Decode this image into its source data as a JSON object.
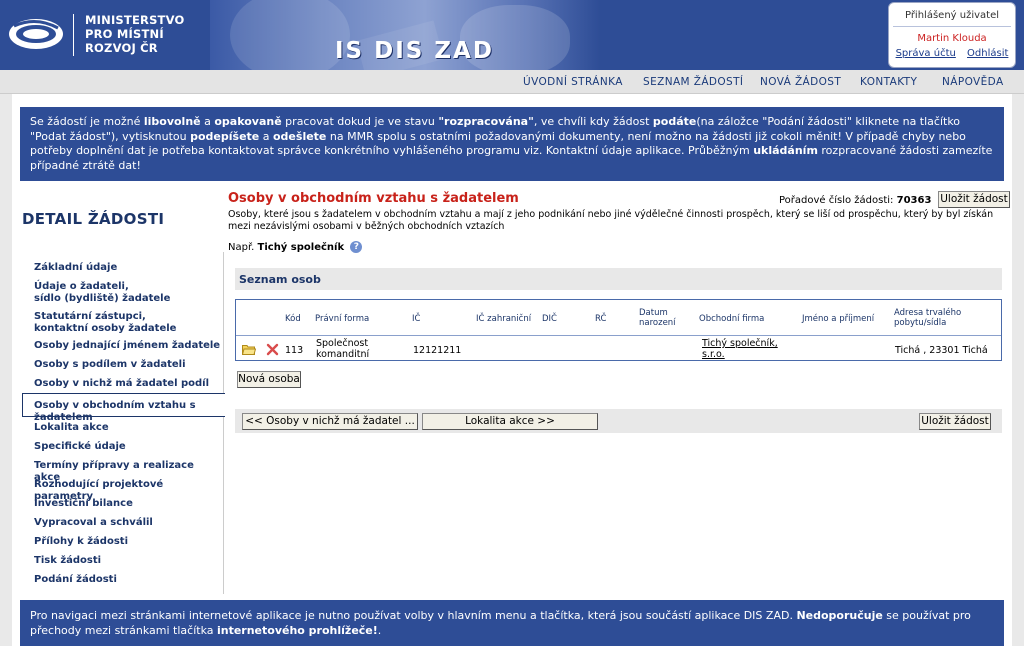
{
  "header": {
    "ministry_lines": [
      "MINISTERSTVO",
      "PRO MÍSTNÍ",
      "ROZVOJ ČR"
    ],
    "app_title": "IS DIS ZAD",
    "user_box_title": "Přihlášený uživatel",
    "user_name": "Martin Klouda",
    "account_link": "Správa účtu",
    "logout_link": "Odhlásit"
  },
  "topnav": [
    "ÚVODNÍ STRÁNKA",
    "SEZNAM ŽÁDOSTÍ",
    "NOVÁ ŽÁDOST",
    "KONTAKTY",
    "NÁPOVĚDA"
  ],
  "info": {
    "p1": "Se žádostí je možné ",
    "b1": "libovolně",
    "p2": " a ",
    "b2": "opakovaně",
    "p3": " pracovat dokud je ve stavu ",
    "b3": "\"rozpracována\"",
    "p4": ", ve chvíli kdy žádost ",
    "b4": "podáte",
    "p5": "(na záložce \"Podání žádosti\" kliknete na tlačítko \"Podat žádost\"), vytisknutou ",
    "b5": "podepíšete",
    "p6": " a ",
    "b6": "odešlete",
    "p7": " na MMR spolu s ostatními požadovanými dokumenty, není možno na žádosti již cokoli měnit! V případě chyby nebo potřeby doplnění dat je potřeba kontaktovat správce konkrétního vyhlášeného programu viz. Kontaktní údaje aplikace. Průběžným ",
    "b7": "ukládáním",
    "p8": " rozpracované žádosti zamezíte případné ztrátě dat!"
  },
  "left": {
    "title": "DETAIL ŽÁDOSTI",
    "items": [
      "Základní údaje",
      "Údaje o žadateli,",
      "sídlo (bydliště) žadatele",
      "Statutární zástupci,",
      "kontaktní osoby žadatele",
      "Osoby jednající jménem žadatele",
      "Osoby s podílem v žadateli",
      "Osoby v nichž má žadatel podíl",
      "Osoby v obchodním vztahu s žadatelem",
      "Lokalita akce",
      "Specifické údaje",
      "Termíny přípravy a realizace akce",
      "Rozhodující projektové parametry",
      "Investiční bilance",
      "Vypracoval a schválil",
      "Přílohy k žádosti",
      "Tisk žádosti",
      "Podání žádosti"
    ]
  },
  "content": {
    "title": "Osoby v obchodním vztahu s žadatelem",
    "seq_label": "Pořadové číslo žádosti:",
    "seq_value": "70363",
    "save_button": "Uložit žádost",
    "description": "Osoby, které jsou s žadatelem v obchodním vztahu a mají z jeho podnikání nebo jiné výdělečné činnosti prospěch, který se liší od prospěchu, který by byl získán mezi nezávislými osobami v běžných obchodních vztazích",
    "example_prefix": "Např. ",
    "example_value": "Tichý společník",
    "help_glyph": "?",
    "list_title": "Seznam osob",
    "columns": [
      "Kód",
      "Právní forma",
      "IČ",
      "IČ zahraniční",
      "DIČ",
      "RČ",
      "Datum",
      "narození",
      "Obchodní firma",
      "Jméno a příjmení",
      "Adresa trvalého",
      "pobytu/sídla"
    ],
    "row": {
      "code": "113",
      "legal_form_1": "Společnost",
      "legal_form_2": "komanditní",
      "ic": "12121211",
      "firm_1": "Tichý společník,",
      "firm_2": "s.r.o.",
      "address": "Tichá , 23301 Tichá"
    },
    "new_person_button": "Nová osoba",
    "prev_button": "<<  Osoby v nichž má žadatel ...",
    "next_button": "Lokalita akce  >>",
    "save_button_bottom": "Uložit žádost"
  },
  "footer": {
    "p1": "Pro navigaci mezi stránkami internetové aplikace je nutno používat volby v hlavním menu a tlačítka, která jsou součástí aplikace DIS ZAD. ",
    "b1": "Nedoporučuje",
    "p2": " se používat pro přechody mezi stránkami tlačítka ",
    "b2": "internetového prohlížeče!",
    "p3": "."
  },
  "colors": {
    "primary": "#2e4d96",
    "title_red": "#c8221a",
    "nav_text": "#1c3568"
  }
}
